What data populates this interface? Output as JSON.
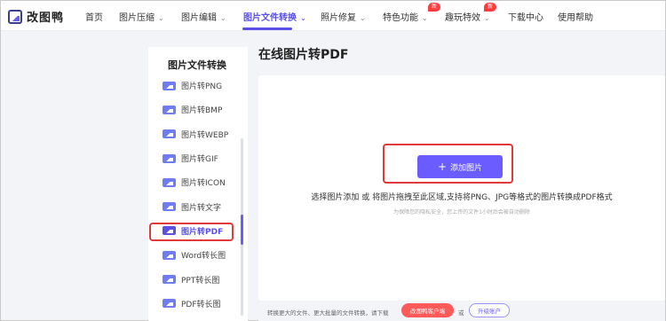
{
  "app": {
    "logo_text": "改图鸭"
  },
  "nav": {
    "items": [
      {
        "label": "首页",
        "chevron": false
      },
      {
        "label": "图片压缩",
        "chevron": true
      },
      {
        "label": "图片编辑",
        "chevron": true
      },
      {
        "label": "图片文件转换",
        "chevron": true,
        "active": true
      },
      {
        "label": "照片修复",
        "chevron": true
      },
      {
        "label": "特色功能",
        "chevron": true,
        "badge": "新"
      },
      {
        "label": "趣玩特效",
        "chevron": true,
        "badge": "新"
      },
      {
        "label": "下载中心",
        "chevron": false
      },
      {
        "label": "使用帮助",
        "chevron": false
      }
    ]
  },
  "sidebar": {
    "title": "图片文件转换",
    "items": [
      {
        "label": "图片转PNG"
      },
      {
        "label": "图片转BMP"
      },
      {
        "label": "图片转WEBP"
      },
      {
        "label": "图片转GIF"
      },
      {
        "label": "图片转ICON"
      },
      {
        "label": "图片转文字"
      },
      {
        "label": "图片转PDF",
        "active": true
      },
      {
        "label": "Word转长图"
      },
      {
        "label": "PPT转长图"
      },
      {
        "label": "PDF转长图"
      }
    ]
  },
  "main": {
    "title": "在线图片转PDF",
    "add_button": "添加图片",
    "hint": "选择图片添加 或 将图片拖拽至此区域,支持将PNG、JPG等格式的图片转换成PDF格式",
    "subhint": "为保障您的隐私安全，您上传的文件1小时后会被自动删除"
  },
  "footer": {
    "text": "转换更大的文件、更大批量的文件转换，请下载",
    "vip_button": "改图鸭客户端",
    "or": "或",
    "upgrade_button": "升级账户"
  },
  "colors": {
    "accent": "#6a5cff",
    "highlight": "#e23a3a",
    "badge": "#ff3b3b"
  }
}
